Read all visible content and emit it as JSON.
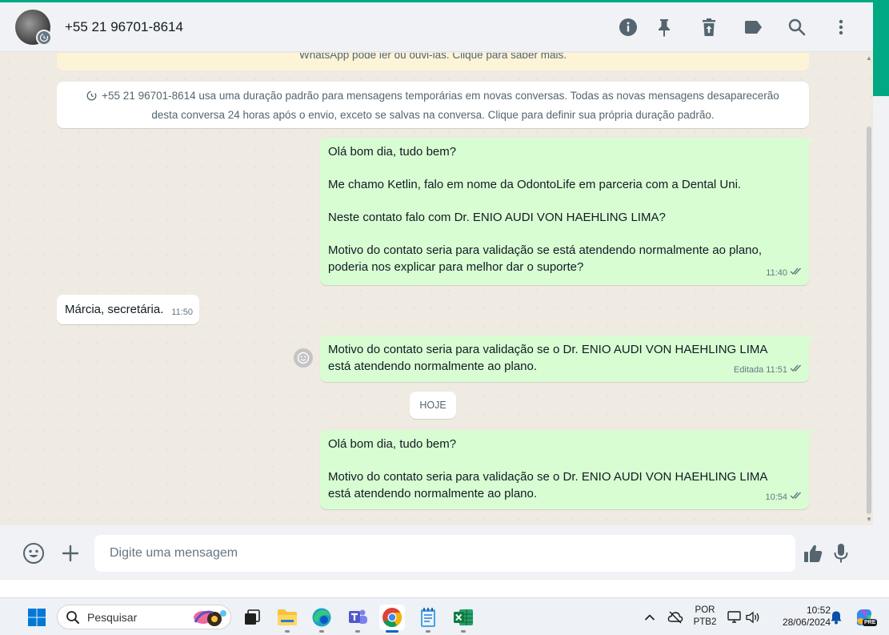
{
  "header": {
    "contact_name": "+55 21 96701-8614",
    "icons": [
      "info-icon",
      "pin-icon",
      "delete-icon",
      "label-icon",
      "search-icon",
      "menu-dots-icon"
    ]
  },
  "chat": {
    "encryption_banner": "WhatsApp pode ler ou ouvi-las. Clique para saber mais.",
    "disappearing_info": "+55 21 96701-8614 usa uma duração padrão para mensagens temporárias em novas conversas. Todas as novas mensagens desaparecerão desta conversa 24 horas após o envio, exceto se salvas na conversa. Clique para definir sua própria duração padrão.",
    "messages": [
      {
        "direction": "out",
        "paragraphs": [
          "Olá bom dia, tudo bem?",
          "Me chamo Ketlin, falo em nome da OdontoLife em parceria com a Dental Uni.",
          "Neste contato falo com Dr. ENIO AUDI VON HAEHLING LIMA?",
          "Motivo do contato seria para validação se está atendendo normalmente ao plano, poderia nos explicar para melhor dar o suporte?"
        ],
        "meta": "11:40",
        "status": "read"
      },
      {
        "direction": "in",
        "paragraphs": [
          "Márcia, secretária."
        ],
        "meta": "11:50"
      },
      {
        "direction": "out",
        "paragraphs": [
          "Motivo do contato seria para validação se o  Dr. ENIO AUDI VON HAEHLING LIMA está atendendo normalmente ao plano."
        ],
        "meta": "Editada 11:51",
        "status": "read"
      },
      {
        "direction": "out",
        "paragraphs": [
          "Olá bom dia, tudo bem?",
          "Motivo do contato seria para validação se o  Dr. ENIO AUDI VON HAEHLING LIMA está atendendo normalmente ao plano."
        ],
        "meta": "10:54",
        "status": "read"
      }
    ],
    "date_chip": "HOJE"
  },
  "composer": {
    "placeholder": "Digite uma mensagem"
  },
  "taskbar": {
    "search_label": "Pesquisar",
    "language_top": "POR",
    "language_bottom": "PTB2",
    "time": "10:52",
    "date": "28/06/2024",
    "copilot_badge": "PRE"
  },
  "colors": {
    "accent": "#00a884",
    "outgoing_bubble": "#d9fdd3",
    "incoming_bubble": "#ffffff",
    "read_tick": "#667781",
    "chat_background": "#efeae2"
  }
}
